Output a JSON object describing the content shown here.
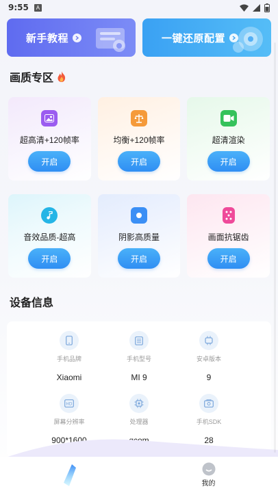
{
  "status_bar": {
    "time": "9:55",
    "notification_icon": "A"
  },
  "banners": [
    {
      "label": "新手教程",
      "icon": "arrow-right-icon"
    },
    {
      "label": "一键还原配置",
      "icon": "arrow-right-icon"
    }
  ],
  "quality_section": {
    "title": "画质专区",
    "icon": "fire-icon"
  },
  "quality_cards": [
    {
      "label": "超高清+120帧率",
      "button": "开启",
      "icon": "image-icon",
      "color": "#9b5cf0"
    },
    {
      "label": "均衡+120帧率",
      "button": "开启",
      "icon": "scale-icon",
      "color": "#f59a3a"
    },
    {
      "label": "超清渲染",
      "button": "开启",
      "icon": "video-icon",
      "color": "#35c25b"
    },
    {
      "label": "音效品质-超高",
      "button": "开启",
      "icon": "music-icon",
      "color": "#25b5e6"
    },
    {
      "label": "阴影高质量",
      "button": "开启",
      "icon": "circle-icon",
      "color": "#3b8ff5"
    },
    {
      "label": "画面抗锯齿",
      "button": "开启",
      "icon": "dice-icon",
      "color": "#ef4a9a"
    }
  ],
  "device_section": {
    "title": "设备信息"
  },
  "device_info": [
    {
      "label": "手机品牌",
      "value": "Xiaomi",
      "icon": "phone-icon"
    },
    {
      "label": "手机型号",
      "value": "MI 9",
      "icon": "id-card-icon"
    },
    {
      "label": "安卓版本",
      "value": "9",
      "icon": "android-icon"
    },
    {
      "label": "屏幕分辨率",
      "value": "900*1600",
      "icon": "hd-icon"
    },
    {
      "label": "处理器",
      "value": "qcom",
      "icon": "chip-icon"
    },
    {
      "label": "手机SDK",
      "value": "28",
      "icon": "sdk-icon"
    }
  ],
  "bottom_nav": [
    {
      "label": "",
      "icon": "home-brand-icon"
    },
    {
      "label": "我的",
      "icon": "profile-icon"
    }
  ]
}
